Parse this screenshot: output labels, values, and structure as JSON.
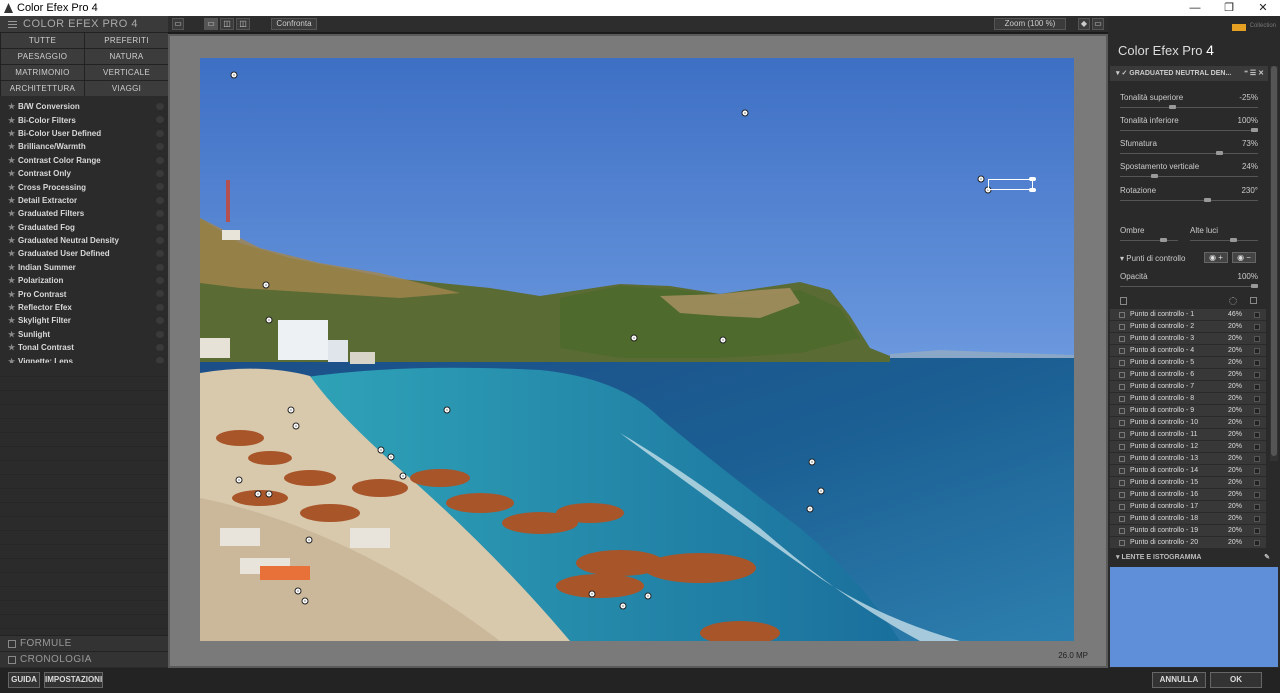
{
  "window": {
    "title": "Color Efex Pro 4",
    "minimize": "—",
    "restore": "❐",
    "close": "✕"
  },
  "left": {
    "header": "COLOR EFEX PRO 4",
    "categories": [
      "TUTTE",
      "PREFERITI",
      "PAESAGGIO",
      "NATURA",
      "MATRIMONIO",
      "VERTICALE",
      "ARCHITETTURA",
      "VIAGGI"
    ],
    "filters": [
      "B/W Conversion",
      "Bi-Color Filters",
      "Bi-Color User Defined",
      "Brilliance/Warmth",
      "Contrast Color Range",
      "Contrast Only",
      "Cross Processing",
      "Detail Extractor",
      "Graduated Filters",
      "Graduated Fog",
      "Graduated Neutral Density",
      "Graduated User Defined",
      "Indian Summer",
      "Polarization",
      "Pro Contrast",
      "Reflector Efex",
      "Skylight Filter",
      "Sunlight",
      "Tonal Contrast",
      "Vignette: Lens"
    ],
    "footer1": "FORMULE",
    "footer2": "CRONOLOGIA"
  },
  "toolbar": {
    "compare": "Confronta",
    "zoom": "Zoom (100 %)"
  },
  "image": {
    "megapixels": "26.0 MP"
  },
  "right": {
    "brand": "Color Efex Pro",
    "brand_num": "4",
    "collection": "Collection",
    "filter_header": "GRADUATED NEUTRAL DEN...",
    "sliders": [
      {
        "label": "Tonalità superiore",
        "value": "-25%",
        "level": 0.375
      },
      {
        "label": "Tonalità inferiore",
        "value": "100%",
        "level": 1.0
      },
      {
        "label": "Sfumatura",
        "value": "73%",
        "level": 0.73
      },
      {
        "label": "Spostamento verticale",
        "value": "24%",
        "level": 0.24
      },
      {
        "label": "Rotazione",
        "value": "230°",
        "level": 0.64
      }
    ],
    "shadows": "Ombre",
    "highlights": "Alte luci",
    "control_points": "Punti di controllo",
    "opacity_label": "Opacità",
    "opacity_value": "100%",
    "cp_rows": [
      {
        "name": "Punto di controllo - 1",
        "pct": "46%"
      },
      {
        "name": "Punto di controllo - 2",
        "pct": "20%"
      },
      {
        "name": "Punto di controllo - 3",
        "pct": "20%"
      },
      {
        "name": "Punto di controllo - 4",
        "pct": "20%"
      },
      {
        "name": "Punto di controllo - 5",
        "pct": "20%"
      },
      {
        "name": "Punto di controllo - 6",
        "pct": "20%"
      },
      {
        "name": "Punto di controllo - 7",
        "pct": "20%"
      },
      {
        "name": "Punto di controllo - 8",
        "pct": "20%"
      },
      {
        "name": "Punto di controllo - 9",
        "pct": "20%"
      },
      {
        "name": "Punto di controllo - 10",
        "pct": "20%"
      },
      {
        "name": "Punto di controllo - 11",
        "pct": "20%"
      },
      {
        "name": "Punto di controllo - 12",
        "pct": "20%"
      },
      {
        "name": "Punto di controllo - 13",
        "pct": "20%"
      },
      {
        "name": "Punto di controllo - 14",
        "pct": "20%"
      },
      {
        "name": "Punto di controllo - 15",
        "pct": "20%"
      },
      {
        "name": "Punto di controllo - 16",
        "pct": "20%"
      },
      {
        "name": "Punto di controllo - 17",
        "pct": "20%"
      },
      {
        "name": "Punto di controllo - 18",
        "pct": "20%"
      },
      {
        "name": "Punto di controllo - 19",
        "pct": "20%"
      },
      {
        "name": "Punto di controllo - 20",
        "pct": "20%"
      }
    ],
    "lens_header": "LENTE E ISTOGRAMMA"
  },
  "bottom": {
    "help": "GUIDA",
    "settings": "IMPOSTAZIONI",
    "cancel": "ANNULLA",
    "ok": "OK"
  }
}
